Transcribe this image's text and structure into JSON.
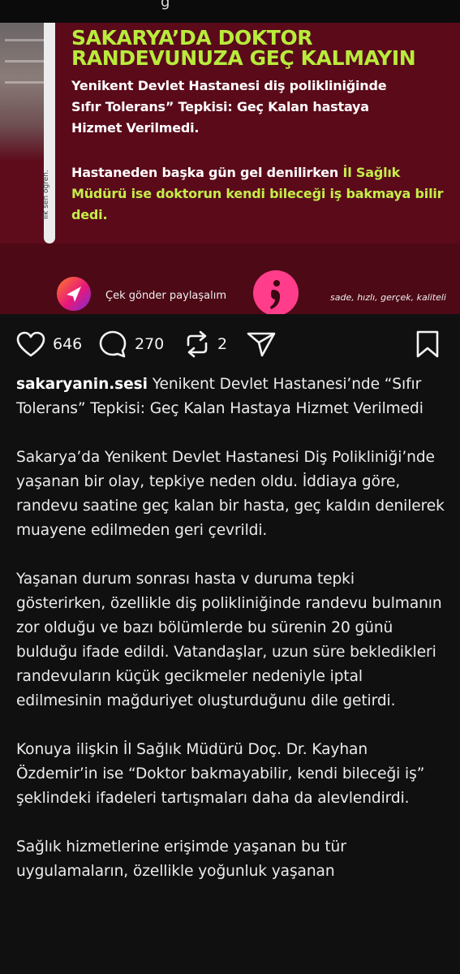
{
  "post": {
    "image": {
      "headline_line1": "SAKARYA’DA DOKTOR",
      "headline_line2": "RANDEVUNUZA GEÇ KALMAYIN",
      "sub_line1": "Yenikent Devlet Hastanesi diş polikliniğinde",
      "sub_line2": "Sıfır Tolerans” Tepkisi: Geç Kalan hastaya",
      "sub_line3": "Hizmet Verilmedi.",
      "quote_part1": "Hastaneden başka gün gel denilirken ",
      "quote_part2": "İl Sağlık Müdürü ise doktorun kendi bileceği iş bakmaya bilir dedi.",
      "vertical_tag": "İlk sen öğren.",
      "send_label": "Çek gönder paylaşalım",
      "slogan": "sade, hızlı, gerçek, kaliteli",
      "colors": {
        "headline": "#b8ec3c",
        "background": "#5b0a1a",
        "logo": "#ff3d8b"
      }
    },
    "actions": {
      "likes": "646",
      "comments": "270",
      "reposts": "2",
      "icons": [
        "heart-icon",
        "comment-icon",
        "repost-icon",
        "share-icon",
        "bookmark-icon"
      ]
    },
    "caption": {
      "username": "sakaryanin.sesi",
      "title": "Yenikent Devlet Hastanesi’nde “Sıfır Tolerans” Tepkisi: Geç Kalan Hastaya Hizmet Verilmedi",
      "paragraphs": [
        "Sakarya’da Yenikent Devlet Hastanesi Diş Polikliniği’nde yaşanan bir olay,  tepkiye neden oldu. İddiaya göre, randevu saatine geç kalan bir hasta, geç kaldın denilerek muayene edilmeden geri çevrildi.",
        "Yaşanan durum sonrası hasta v duruma tepki gösterirken, özellikle diş polikliniğinde randevu bulmanın zor olduğu ve bazı bölümlerde bu sürenin 20 günü bulduğu ifade edildi. Vatandaşlar, uzun süre bekledikleri randevuların küçük gecikmeler nedeniyle iptal edilmesinin mağduriyet oluşturduğunu dile getirdi.",
        "Konuya ilişkin  İl Sağlık Müdürü Doç. Dr. Kayhan Özdemir’in ise “Doktor bakmayabilir, kendi bileceği iş” şeklindeki ifadeleri tartışmaları daha da alevlendirdi.",
        "Sağlık hizmetlerine erişimde yaşanan bu tür uygulamaların, özellikle yoğunluk yaşanan"
      ]
    }
  }
}
